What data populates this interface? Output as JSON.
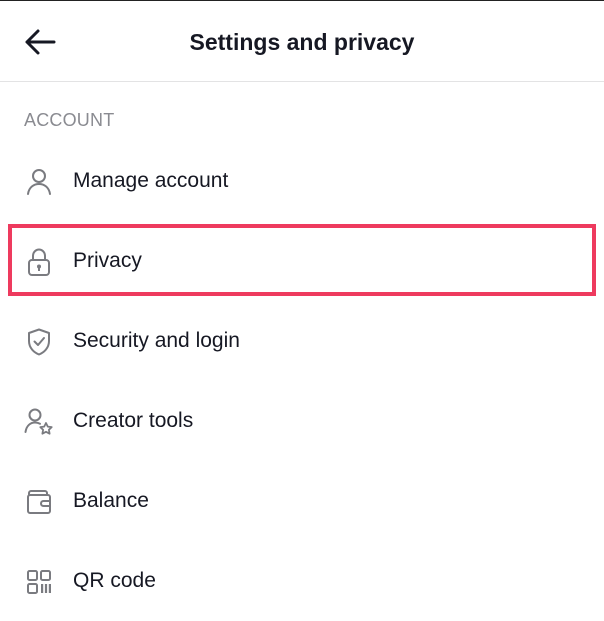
{
  "header": {
    "title": "Settings and privacy",
    "back_icon": "arrow-left-icon"
  },
  "section": {
    "label": "ACCOUNT"
  },
  "menu": {
    "items": [
      {
        "label": "Manage account",
        "icon": "person-icon"
      },
      {
        "label": "Privacy",
        "icon": "lock-icon"
      },
      {
        "label": "Security and login",
        "icon": "shield-check-icon"
      },
      {
        "label": "Creator tools",
        "icon": "person-star-icon"
      },
      {
        "label": "Balance",
        "icon": "wallet-icon"
      },
      {
        "label": "QR code",
        "icon": "qr-code-icon"
      }
    ]
  },
  "colors": {
    "highlight": "#ee3a5e",
    "text": "#161823",
    "muted": "#8a8b91",
    "icon": "#7a7b80"
  }
}
